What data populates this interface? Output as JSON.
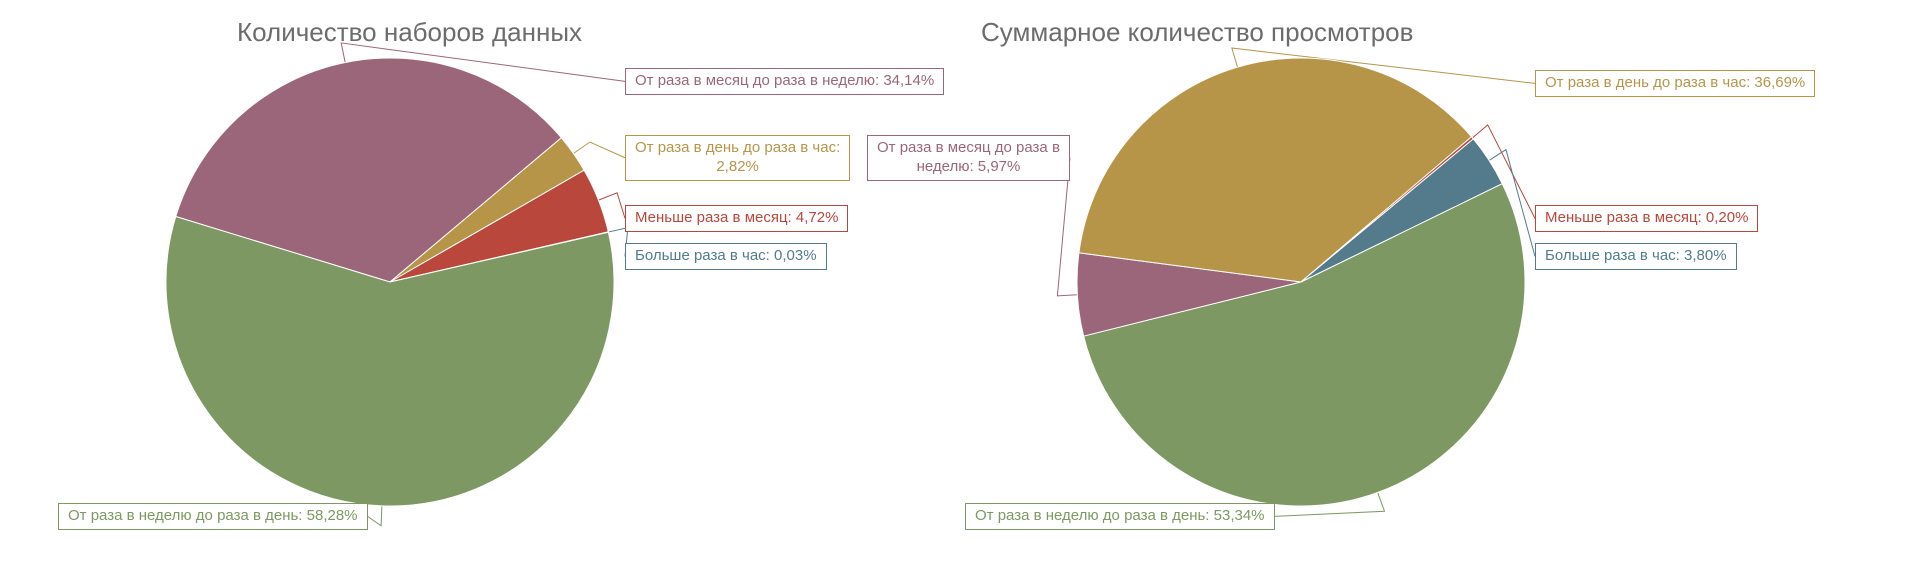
{
  "colors": {
    "green": "#7d9862",
    "mauve": "#9b6679",
    "gold": "#b79548",
    "red": "#b9473c",
    "teal": "#537b8c",
    "title": "#6c6c6c"
  },
  "chart_data": [
    {
      "type": "pie",
      "title": "Количество наборов данных",
      "series": [
        {
          "name": "От раза в неделю до раза в день",
          "value": 58.28,
          "color": "green",
          "label": "От раза в неделю до раза в день: 58,28%"
        },
        {
          "name": "От раза в месяц до раза в неделю",
          "value": 34.14,
          "color": "mauve",
          "label": "От раза в месяц до раза в неделю: 34,14%"
        },
        {
          "name": "От раза в день до раза в час",
          "value": 2.82,
          "color": "gold",
          "label": "От раза в день до раза в час: 2,82%"
        },
        {
          "name": "Меньше раза в месяц",
          "value": 4.72,
          "color": "red",
          "label": "Меньше раза в месяц: 4,72%"
        },
        {
          "name": "Больше раза в час",
          "value": 0.03,
          "color": "teal",
          "label": "Больше раза в час: 0,03%"
        }
      ]
    },
    {
      "type": "pie",
      "title": "Суммарное количество просмотров",
      "series": [
        {
          "name": "От раза в неделю до раза в день",
          "value": 53.34,
          "color": "green",
          "label": "От раза в неделю до раза в день: 53,34%"
        },
        {
          "name": "От раза в месяц до раза в неделю",
          "value": 5.97,
          "color": "mauve",
          "label": "От раза в месяц до раза в неделю: 5,97%"
        },
        {
          "name": "От раза в день до раза в час",
          "value": 36.69,
          "color": "gold",
          "label": "От раза в день до раза в час: 36,69%"
        },
        {
          "name": "Меньше раза в месяц",
          "value": 0.2,
          "color": "red",
          "label": "Меньше раза в месяц: 0,20%"
        },
        {
          "name": "Больше раза в час",
          "value": 3.8,
          "color": "teal",
          "label": "Больше раза в час: 3,80%"
        }
      ]
    }
  ]
}
